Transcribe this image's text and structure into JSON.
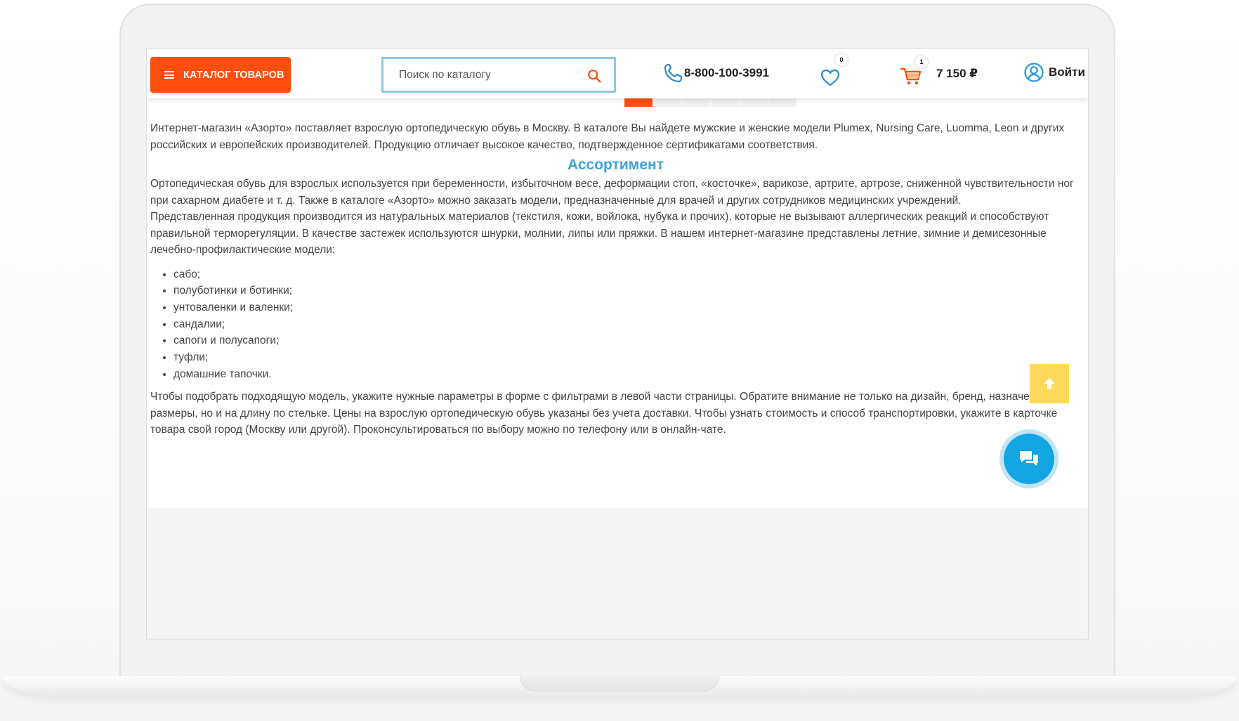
{
  "header": {
    "catalog_label": "КАТАЛОГ ТОВАРОВ",
    "search_placeholder": "Поиск по каталогу",
    "phone": "8-800-100-3991",
    "wishlist_count": "0",
    "cart_count": "1",
    "cart_total": "7 150 ₽",
    "login_label": "Войти"
  },
  "slider": {
    "dot_count": 6,
    "active_index": 0
  },
  "content": {
    "intro": "Интернет-магазин «Азорто» поставляет взрослую ортопедическую обувь в Москву. В каталоге Вы найдете мужские и женские модели Plumex, Nursing Care, Luomma, Leon и других российских и европейских производителей. Продукцию отличает высокое качество, подтвержденное сертификатами соответствия.",
    "heading": "Ассортимент",
    "para1": "Ортопедическая обувь для взрослых используется при беременности, избыточном весе, деформации стоп, «косточке», варикозе, артрите, артрозе, сниженной чувствительности ног при сахарном диабете и т. д. Также в каталоге «Азорто» можно заказать модели, предназначенные для врачей и других сотрудников медицинских учреждений.",
    "para2": "Представленная продукция производится из натуральных материалов (текстиля, кожи, войлока, нубука и прочих), которые не вызывают аллергических реакций и способствуют правильной терморегуляции. В качестве застежек используются шнурки, молнии, липы или пряжки. В нашем интернет-магазине представлены летние, зимние и демисезонные лечебно-профилактические модели:",
    "items": [
      "сабо;",
      "полуботинки и ботинки;",
      "унтоваленки и валенки;",
      "сандалии;",
      "сапоги и полусапоги;",
      "туфли;",
      "домашние тапочки."
    ],
    "para3": "Чтобы подобрать подходящую модель, укажите нужные параметры в форме с фильтрами в левой части страницы. Обратите внимание не только на дизайн, бренд, назначение и размеры, но и на длину по стельке. Цены на взрослую ортопедическую обувь указаны без учета доставки. Чтобы узнать стоимость и способ транспортировки, укажите в карточке товара свой город (Москву или другой). Проконсультироваться по выбору можно по телефону или в онлайн-чате."
  },
  "colors": {
    "accent_orange": "#ff4e0e",
    "search_border": "#8fc6e2",
    "heading_blue": "#3fa3d3",
    "scroll_top_yellow": "#ffd95a",
    "chat_blue": "#14a5e3"
  },
  "icons": {
    "menu": "burger-icon",
    "search": "search-icon",
    "phone": "phone-icon",
    "wishlist": "heart-icon",
    "cart": "cart-icon",
    "login": "user-icon",
    "scroll_top": "arrow-up-icon",
    "chat": "chat-icon"
  }
}
